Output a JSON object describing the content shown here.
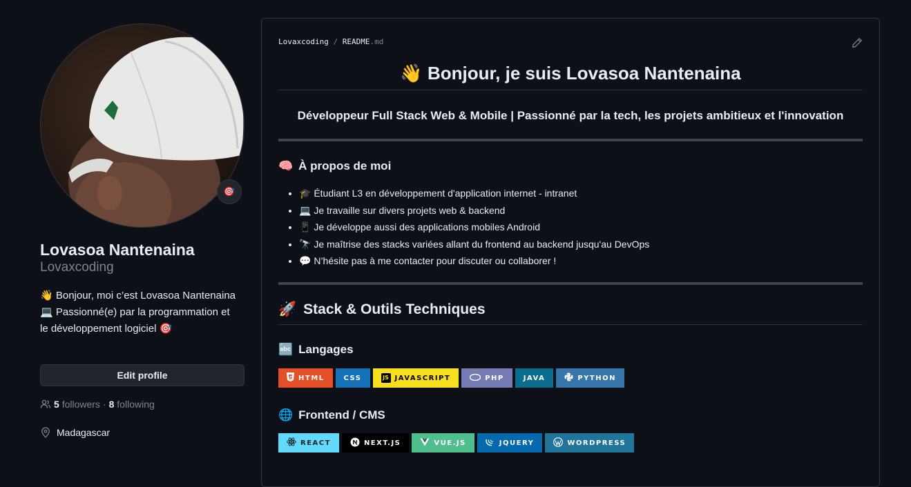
{
  "profile": {
    "name": "Lovasoa Nantenaina",
    "login": "Lovaxcoding",
    "status_emoji": "🎯",
    "bio": "👋 Bonjour, moi c’est Lovasoa Nantenaina 💻 Passionné(e) par la programmation et le développement logiciel 🎯",
    "edit_button": "Edit profile",
    "followers_count": "5",
    "followers_label": "followers",
    "separator": "·",
    "following_count": "8",
    "following_label": "following",
    "location": "Madagascar"
  },
  "readme": {
    "breadcrumb_owner": "Lovaxcoding",
    "breadcrumb_sep": "/",
    "breadcrumb_file": "README",
    "breadcrumb_ext": ".md",
    "title": "👋 Bonjour, je suis Lovasoa Nantenaina",
    "subtitle": "Développeur Full Stack Web & Mobile | Passionné par la tech, les projets ambitieux et l'innovation",
    "about_heading": "À propos de moi",
    "about_icon": "🧠",
    "about_items": [
      {
        "icon": "🎓",
        "text": "Étudiant L3 en développement d'application internet - intranet"
      },
      {
        "icon": "💻",
        "text": "Je travaille sur divers projets web & backend"
      },
      {
        "icon": "📱",
        "text": "Je développe aussi des applications mobiles Android"
      },
      {
        "icon": "🔭",
        "text": "Je maîtrise des stacks variées allant du frontend au backend jusqu'au DevOps"
      },
      {
        "icon": "💬",
        "text": "N’hésite pas à me contacter pour discuter ou collaborer !"
      }
    ],
    "stack_heading": "Stack & Outils Techniques",
    "stack_icon": "🚀",
    "languages_heading": "Langages",
    "languages_icon": "🔤",
    "languages": [
      {
        "label": "HTML",
        "color": "#e34f26"
      },
      {
        "label": "CSS",
        "color": "#1572b6"
      },
      {
        "label": "JAVASCRIPT",
        "color": "#f7df1e"
      },
      {
        "label": "PHP",
        "color": "#777bb4"
      },
      {
        "label": "JAVA",
        "color": "#0b6e8f"
      },
      {
        "label": "PYTHON",
        "color": "#3776ab"
      }
    ],
    "frontend_heading": "Frontend / CMS",
    "frontend_icon": "🌐",
    "frontend": [
      {
        "label": "REACT",
        "color": "#61dafb"
      },
      {
        "label": "NEXT.JS",
        "color": "#000000"
      },
      {
        "label": "VUE.JS",
        "color": "#4fc08d"
      },
      {
        "label": "JQUERY",
        "color": "#0769ad"
      },
      {
        "label": "WORDPRESS",
        "color": "#21759b"
      }
    ]
  },
  "icons": {
    "pencil": "pencil-icon",
    "people": "people-icon",
    "location": "location-pin-icon"
  }
}
